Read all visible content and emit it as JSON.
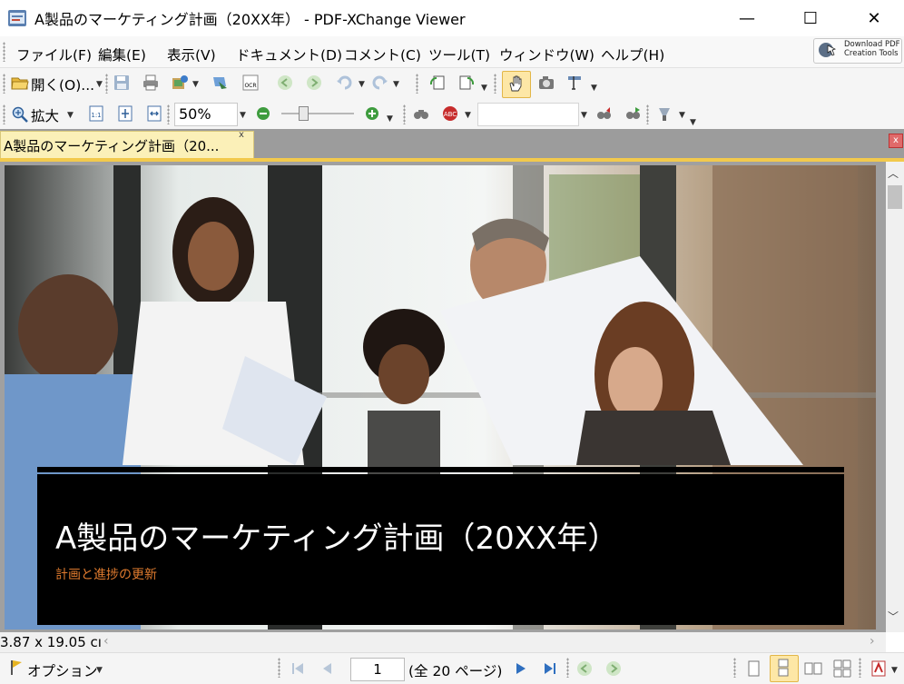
{
  "window": {
    "title": "A製品のマーケティング計画（20XX年） - PDF-XChange Viewer",
    "minimize_glyph": "—",
    "maximize_glyph": "☐",
    "close_glyph": "✕"
  },
  "menu": {
    "items": [
      "ファイル(F)",
      "編集(E)",
      "表示(V)",
      "ドキュメント(D)",
      "コメント(C)",
      "ツール(T)",
      "ウィンドウ(W)",
      "ヘルプ(H)"
    ],
    "download_line1": "Download PDF",
    "download_line2": "Creation Tools"
  },
  "toolbar1": {
    "open_label": "開く(O)..."
  },
  "toolbar2": {
    "zoom_tool_label": "拡大",
    "zoom_value": "50%"
  },
  "tabs": {
    "active_tab": "A製品のマーケティング計画（20...",
    "close_glyph": "x",
    "panel_close_glyph": "x"
  },
  "slide": {
    "title": "A製品のマーケティング計画（20XX年）",
    "subtitle": "計画と進捗の更新"
  },
  "status": {
    "page_size": "3.87 x 19.05 cı",
    "options_label": "オプション",
    "current_page": "1",
    "page_total": "(全 20 ページ)"
  },
  "colors": {
    "tab_active": "#fbf0b8",
    "tab_accent": "#f2c94c",
    "subtitle": "#e07b2e"
  }
}
